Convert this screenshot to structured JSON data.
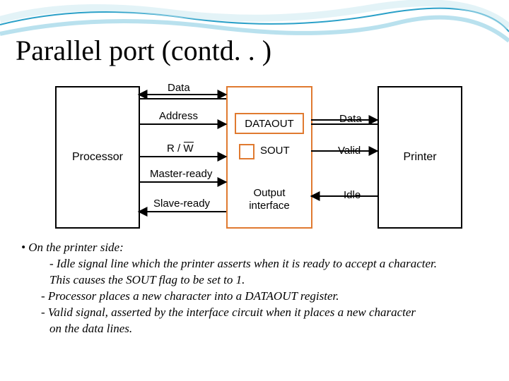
{
  "title": "Parallel port (contd. . )",
  "diagram": {
    "left_box": "Processor",
    "right_box": "Printer",
    "interface": {
      "dataout": "DATAOUT",
      "sout": "SOUT",
      "label": "Output interface"
    },
    "signals_left": {
      "data": "Data",
      "address": "Address",
      "rw": "R / W",
      "master_ready": "Master-ready",
      "slave_ready": "Slave-ready"
    },
    "signals_right": {
      "data": "Data",
      "valid": "Valid",
      "idle": "Idle"
    }
  },
  "bullets": {
    "heading": "On the printer side:",
    "l1a": "- Idle signal line which the printer asserts when it is ready to accept a character.",
    "l1b": "This causes the SOUT flag to be set to 1.",
    "l2": "- Processor places a new character into a DATAOUT register.",
    "l3a": "- Valid signal, asserted by the interface circuit when it places a new character",
    "l3b": "on the data lines."
  },
  "chart_data": {
    "type": "table",
    "title": "Parallel port output-interface block diagram",
    "blocks": [
      {
        "name": "Processor",
        "role": "cpu"
      },
      {
        "name": "Output interface",
        "role": "interface",
        "registers": [
          "DATAOUT",
          "SOUT"
        ]
      },
      {
        "name": "Printer",
        "role": "device"
      }
    ],
    "signals": [
      {
        "from": "Processor",
        "to": "Output interface",
        "name": "Data",
        "direction": "bidirectional"
      },
      {
        "from": "Processor",
        "to": "Output interface",
        "name": "Address",
        "direction": "out"
      },
      {
        "from": "Processor",
        "to": "Output interface",
        "name": "R/W̄",
        "direction": "out"
      },
      {
        "from": "Processor",
        "to": "Output interface",
        "name": "Master-ready",
        "direction": "out"
      },
      {
        "from": "Output interface",
        "to": "Processor",
        "name": "Slave-ready",
        "direction": "out"
      },
      {
        "from": "Output interface",
        "to": "Printer",
        "name": "Data",
        "direction": "out"
      },
      {
        "from": "Output interface",
        "to": "Printer",
        "name": "Valid",
        "direction": "out"
      },
      {
        "from": "Printer",
        "to": "Output interface",
        "name": "Idle",
        "direction": "out"
      }
    ]
  }
}
